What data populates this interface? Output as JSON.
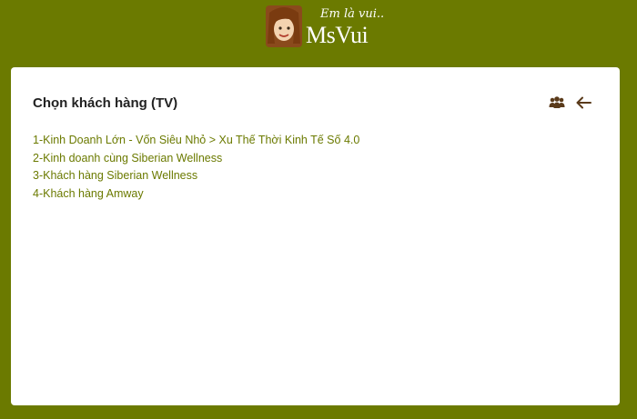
{
  "header": {
    "logo_tagline": "Em là vui..",
    "logo_name": "MsVui"
  },
  "card": {
    "title": "Chọn khách hàng (TV)",
    "icons": [
      "group-icon",
      "arrow-left-icon"
    ],
    "items": [
      {
        "label": "1-Kinh Doanh Lớn - Vốn Siêu Nhỏ > Xu Thế Thời Kinh Tế Số 4.0"
      },
      {
        "label": "2-Kinh doanh cùng Siberian Wellness"
      },
      {
        "label": "3-Khách hàng Siberian Wellness"
      },
      {
        "label": "4-Khách hàng Amway"
      }
    ]
  },
  "colors": {
    "background": "#6b7a00",
    "link": "#6b7a00",
    "card": "#ffffff",
    "icon": "#5a3a1a"
  }
}
